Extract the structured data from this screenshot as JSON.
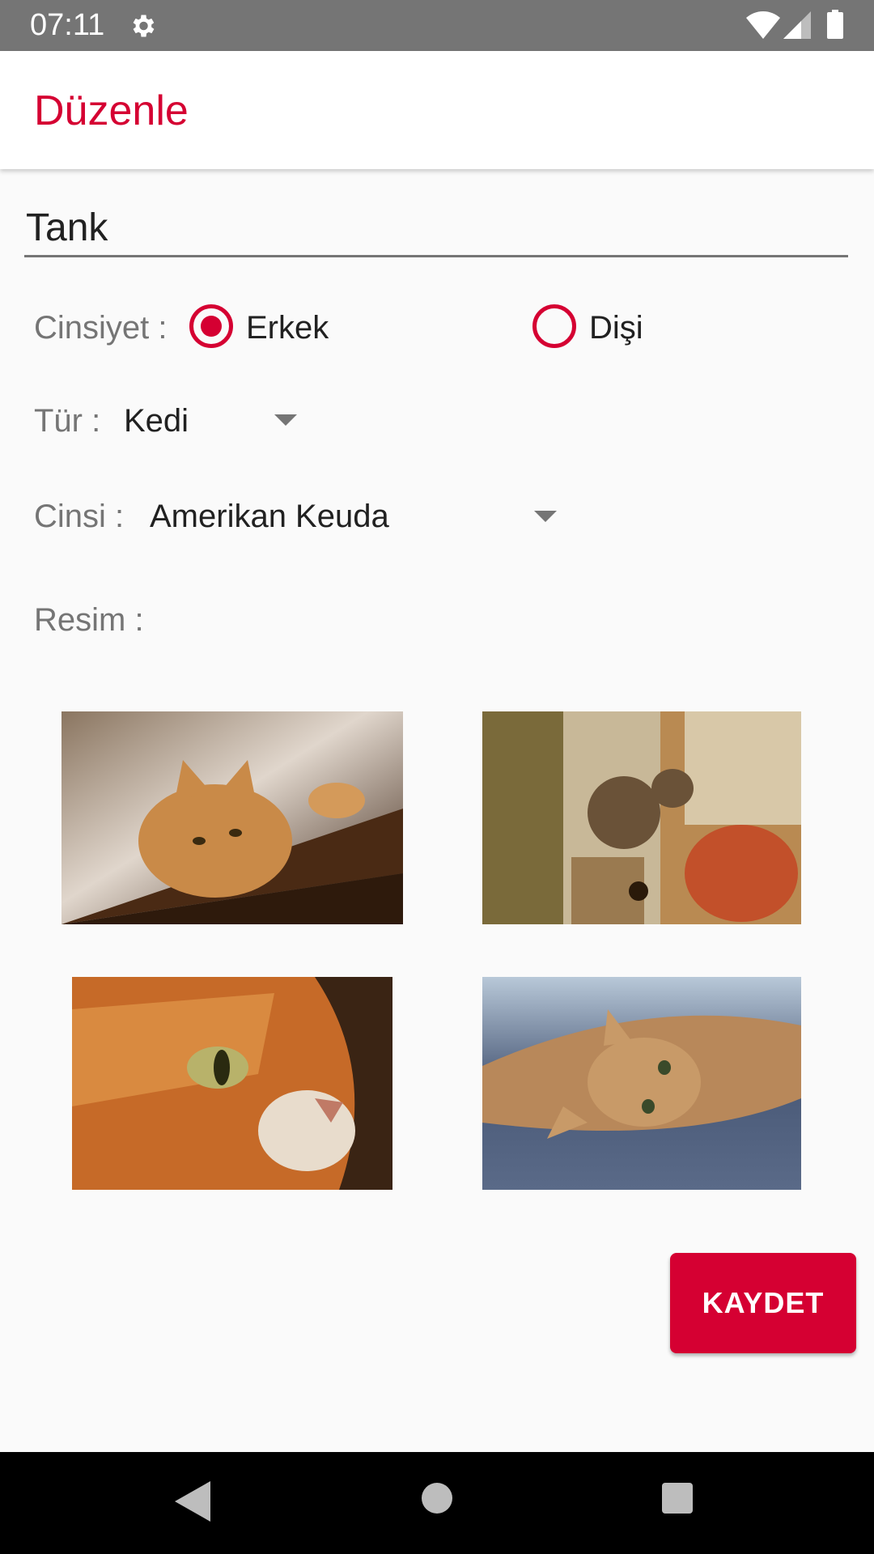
{
  "status_bar": {
    "time": "07:11"
  },
  "app_bar": {
    "title": "Düzenle"
  },
  "form": {
    "name_value": "Tank",
    "gender": {
      "label": "Cinsiyet :",
      "options": [
        {
          "label": "Erkek",
          "selected": true
        },
        {
          "label": "Dişi",
          "selected": false
        }
      ]
    },
    "type": {
      "label": "Tür :",
      "value": "Kedi"
    },
    "breed": {
      "label": "Cinsi :",
      "value": "Amerikan Keuda"
    },
    "image": {
      "label": "Resim :"
    }
  },
  "photos": [
    {
      "icon": "cat-photo-1"
    },
    {
      "icon": "cat-photo-2"
    },
    {
      "icon": "cat-photo-3"
    },
    {
      "icon": "cat-photo-4"
    }
  ],
  "actions": {
    "save_label": "KAYDET"
  },
  "colors": {
    "accent": "#d50032",
    "status_bar": "#757575",
    "background": "#fafafa"
  }
}
